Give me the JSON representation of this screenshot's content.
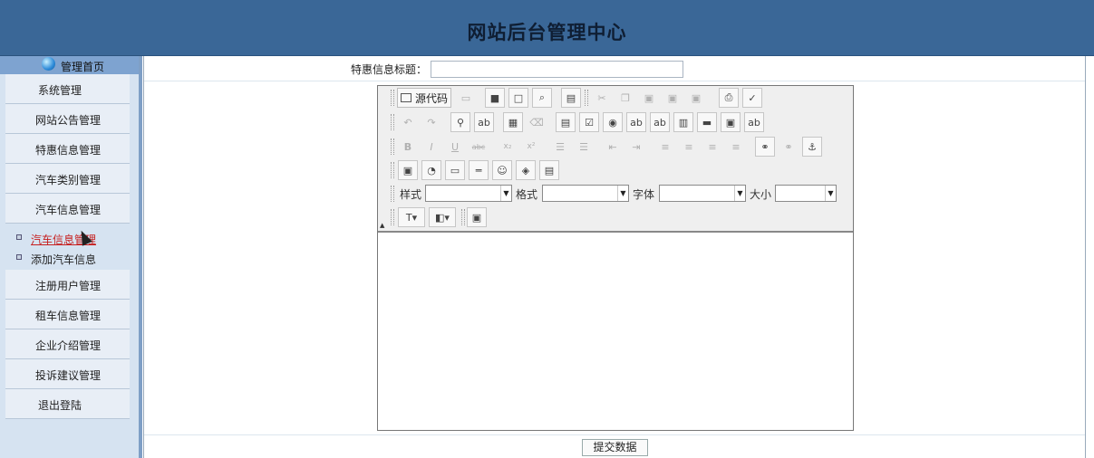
{
  "header": {
    "title": "网站后台管理中心"
  },
  "sidebar": {
    "home_label": "管理首页",
    "items": [
      {
        "label": "系统管理"
      },
      {
        "label": "网站公告管理"
      },
      {
        "label": "特惠信息管理"
      },
      {
        "label": "汽车类别管理"
      },
      {
        "label": "汽车信息管理"
      },
      {
        "label": "注册用户管理"
      },
      {
        "label": "租车信息管理"
      },
      {
        "label": "企业介绍管理"
      },
      {
        "label": "投诉建议管理"
      },
      {
        "label": "退出登陆"
      }
    ],
    "sub_items": [
      {
        "label": "汽车信息管理",
        "active": true
      },
      {
        "label": "添加汽车信息",
        "active": false
      }
    ]
  },
  "form": {
    "title_label": "特惠信息标题：",
    "title_value": "",
    "submit_label": "提交数据"
  },
  "editor": {
    "source_label": "源代码",
    "style_label": "样式",
    "format_label": "格式",
    "font_label": "字体",
    "size_label": "大小",
    "style_value": "",
    "format_value": "",
    "font_value": "",
    "size_value": "",
    "content": ""
  },
  "colors": {
    "header_bg": "#3a6797",
    "sidebar_bg": "#d6e3f1",
    "active_link": "#c62020"
  }
}
